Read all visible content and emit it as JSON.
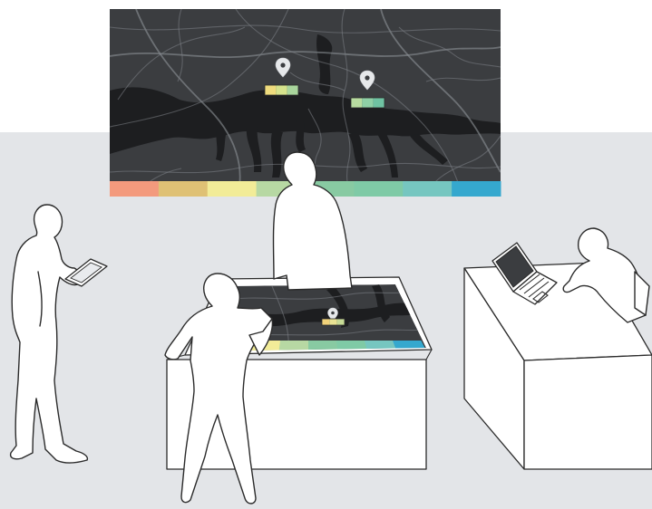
{
  "scene": {
    "wall_color": "#ffffff",
    "floor_color": "#e3e5e8",
    "map_background": "#3b3d40",
    "river_color": "#1d1e20",
    "road_color": "#7d8186"
  },
  "legend_colors": [
    "#f39a7d",
    "#dfc175",
    "#f2ec98",
    "#b7d8a3",
    "#88caa2",
    "#7fcaa6",
    "#76c6c0",
    "#35a8ce"
  ],
  "markers": [
    {
      "icon": "map-pin-icon",
      "level_colors": [
        "#efdc7e",
        "#d6e38c",
        "#a9d59c"
      ]
    },
    {
      "icon": "map-pin-icon",
      "level_colors": [
        "#b8dca0",
        "#8fd0a6",
        "#6fc2a2"
      ]
    },
    {
      "icon": "map-pin-icon",
      "level_colors": [
        "#f1d27a",
        "#e9e394",
        "#c7db96"
      ]
    }
  ],
  "devices": [
    "wall-display",
    "interactive-table",
    "tablet",
    "laptop"
  ]
}
